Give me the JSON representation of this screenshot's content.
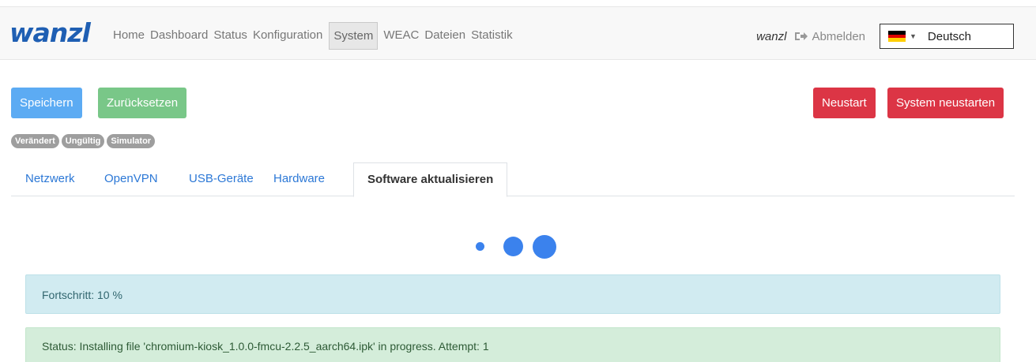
{
  "navbar": {
    "logo": "wanzl",
    "links": [
      "Home",
      "Dashboard",
      "Status",
      "Konfiguration",
      "System",
      "WEAC",
      "Dateien",
      "Statistik"
    ],
    "active": "System",
    "username": "wanzl",
    "logout_label": "Abmelden",
    "language": "Deutsch"
  },
  "toolbar": {
    "save_label": "Speichern",
    "reset_label": "Zurücksetzen",
    "restart_label": "Neustart",
    "system_restart_label": "System neustarten"
  },
  "badges": [
    "Verändert",
    "Ungültig",
    "Simulator"
  ],
  "tabs": [
    "Netzwerk",
    "OpenVPN",
    "USB-Geräte",
    "Hardware",
    "Software aktualisieren"
  ],
  "active_tab": "Software aktualisieren",
  "progress": {
    "text": "Fortschritt: 10 %"
  },
  "status": {
    "text": "Status: Installing file 'chromium-kiosk_1.0.0-fmcu-2.2.5_aarch64.ipk' in progress. Attempt: 1"
  },
  "colors": {
    "brand": "#1f5fb3",
    "primary": "#5cabf3",
    "success": "#79c788",
    "danger": "#dc3545",
    "link": "#2c78d6",
    "spinner": "#3b82ed"
  },
  "icons": {
    "logout": "sign-out-icon",
    "flag": "german-flag-icon",
    "caret": "caret-down-icon",
    "spinner": "loading-dots-icon"
  }
}
